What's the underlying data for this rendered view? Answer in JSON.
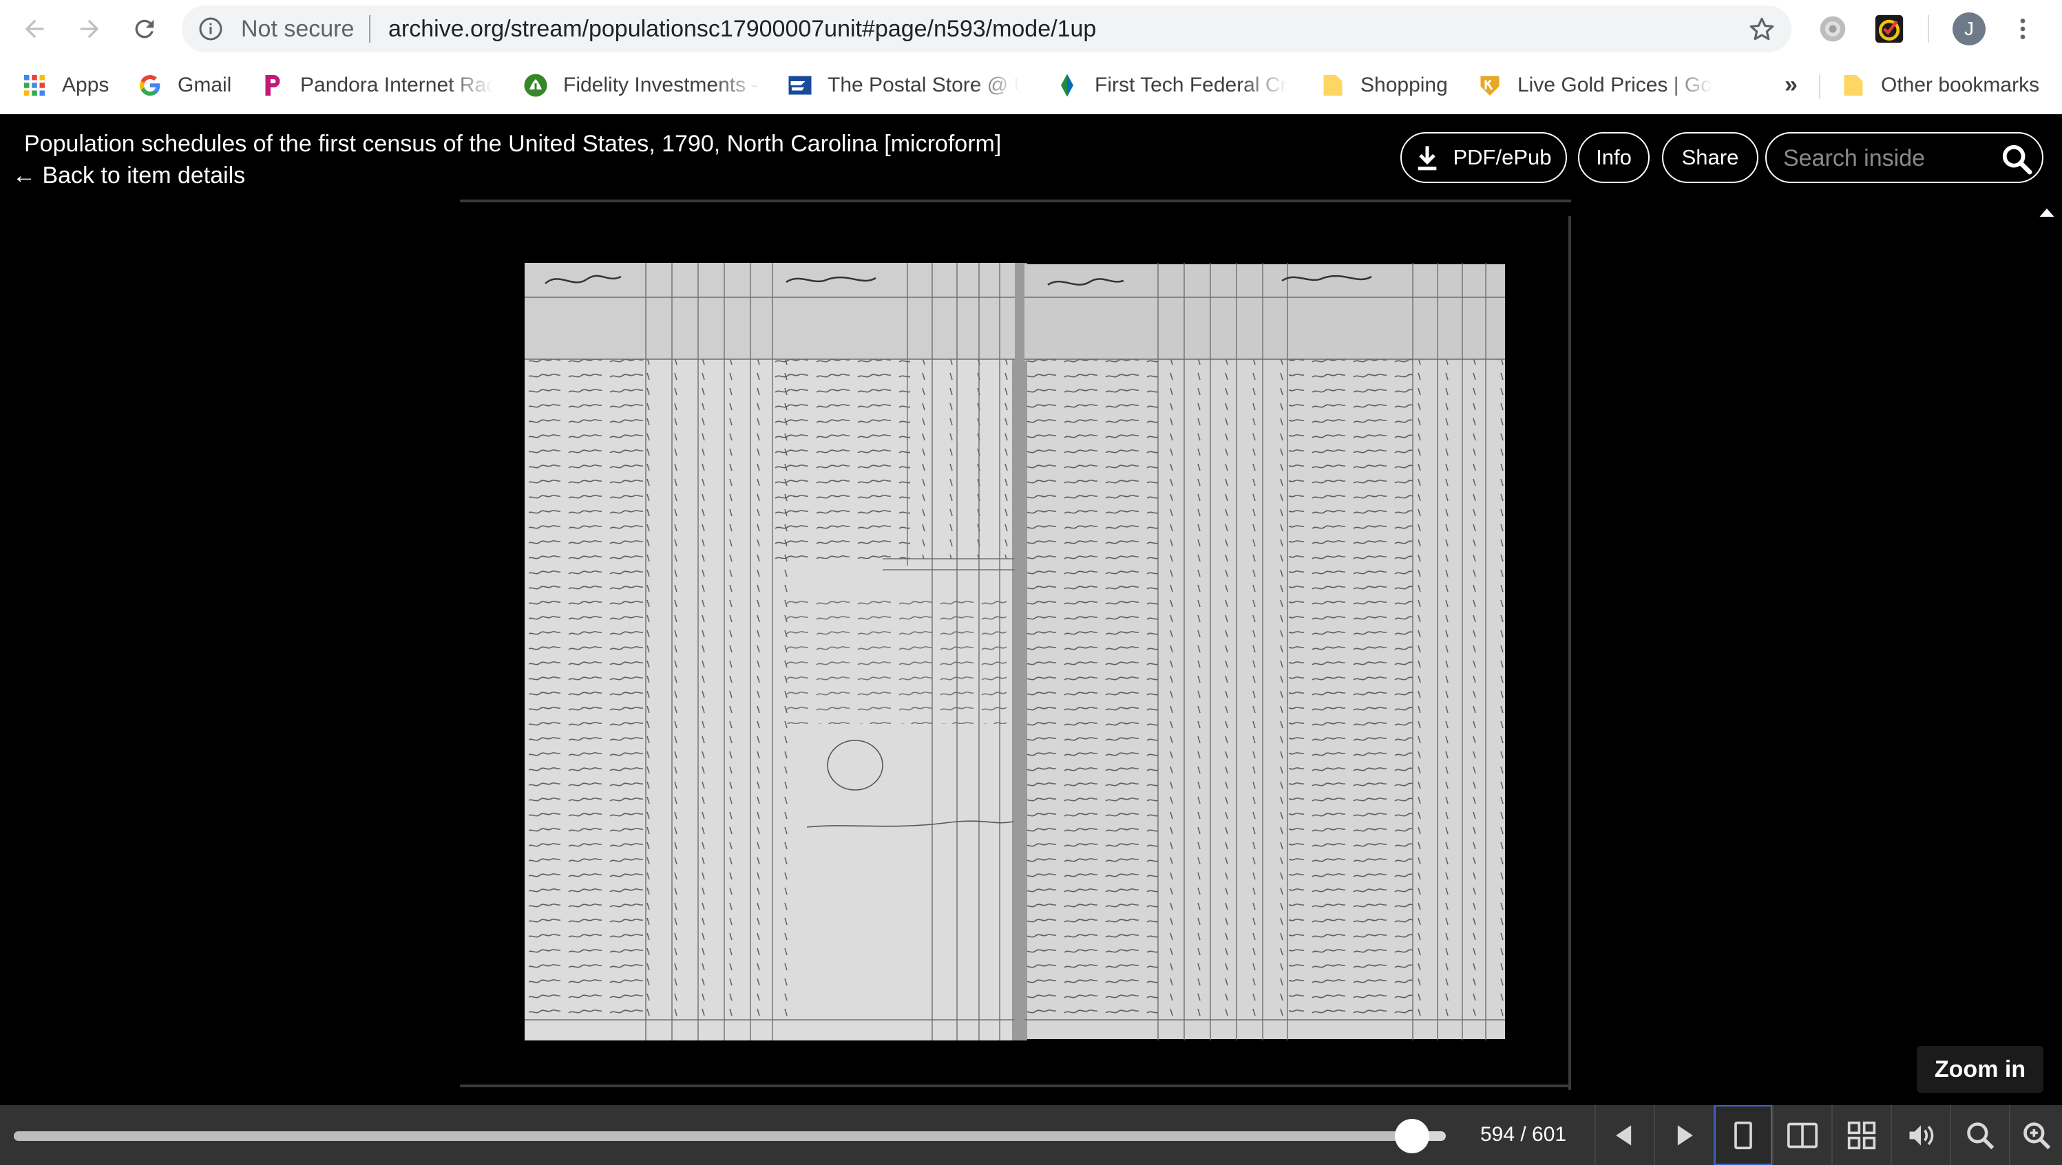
{
  "browser": {
    "secure_label": "Not secure",
    "url": "archive.org/stream/populationsc17900007unit#page/n593/mode/1up",
    "avatar_letter": "J",
    "bookmarks": [
      {
        "label": "Apps",
        "icon": "apps-grid-icon"
      },
      {
        "label": "Gmail",
        "icon": "google-g-icon"
      },
      {
        "label": "Pandora Internet Rad",
        "icon": "pandora-icon"
      },
      {
        "label": "Fidelity Investments -",
        "icon": "fidelity-icon"
      },
      {
        "label": "The Postal Store @ U",
        "icon": "usps-icon"
      },
      {
        "label": "First Tech Federal Cre",
        "icon": "firsttech-icon"
      },
      {
        "label": "Shopping",
        "icon": "folder-icon"
      },
      {
        "label": "Live Gold Prices | Gol",
        "icon": "kitco-icon"
      }
    ],
    "more_label": "»",
    "other_bookmarks": "Other bookmarks"
  },
  "header": {
    "title": "Population schedules of the first census of the United States, 1790, North Carolina [microform]",
    "back_link": "← Back to item details",
    "pdf_label": "PDF/ePub",
    "info_label": "Info",
    "share_label": "Share",
    "search_placeholder": "Search inside"
  },
  "viewer": {
    "page_image_alt": "Census schedule scan",
    "zoom_tooltip": "Zoom in"
  },
  "navbar": {
    "page_counter": "594 / 601",
    "progress": 0.9883
  },
  "colors": {
    "chrome_bg": "#ffffff",
    "viewer_bg": "#000000",
    "navbar_bg": "#333333",
    "active_mode": "#3b62c8"
  }
}
